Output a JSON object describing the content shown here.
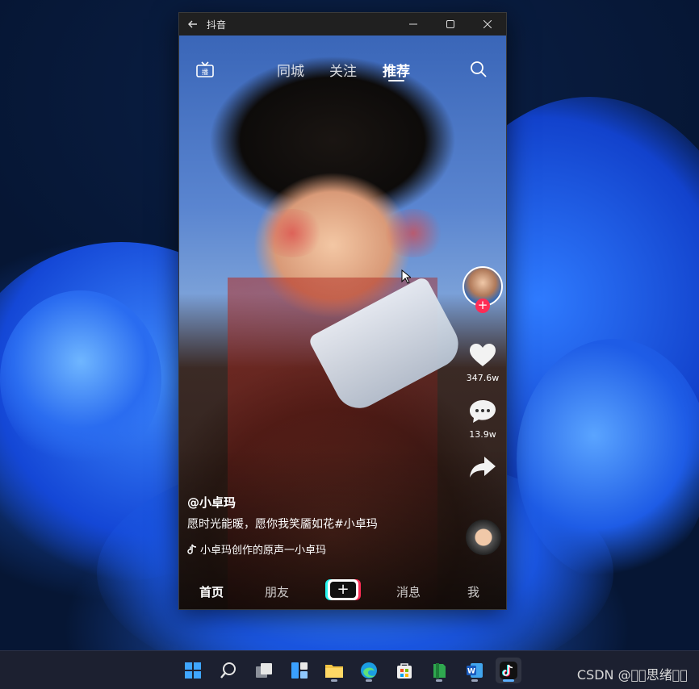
{
  "window": {
    "title": "抖音",
    "back_icon": "arrow-left-icon",
    "controls": [
      "minimize-icon",
      "maximize-icon",
      "close-icon"
    ]
  },
  "top_nav": {
    "live_icon": "live-icon",
    "tabs": [
      {
        "label": "同城",
        "active": false
      },
      {
        "label": "关注",
        "active": false
      },
      {
        "label": "推荐",
        "active": true
      }
    ],
    "search_icon": "search-icon"
  },
  "actions": {
    "likes": "347.6w",
    "comments": "13.9w",
    "follow_symbol": "+"
  },
  "caption": {
    "author": "@小卓玛",
    "description": "愿时光能暖，愿你我笑靥如花#小卓玛",
    "music": "小卓玛创作的原声一小卓玛"
  },
  "bottom_nav": {
    "items": [
      {
        "label": "首页",
        "active": true
      },
      {
        "label": "朋友",
        "active": false
      },
      {
        "label": "+",
        "active": false
      },
      {
        "label": "消息",
        "active": false
      },
      {
        "label": "我",
        "active": false
      }
    ]
  },
  "taskbar": {
    "icons": [
      "windows-start-icon",
      "search-icon",
      "task-view-icon",
      "widgets-icon",
      "file-explorer-icon",
      "edge-icon",
      "store-icon",
      "green-app-icon",
      "word-icon",
      "douyin-icon"
    ],
    "watermark": "CSDN @\u0000\u0000思绪\u0000\u0000"
  },
  "colors": {
    "accent": "#fe2c55",
    "cyan": "#25f4ee",
    "taskbar": "#1c2030",
    "titlebar": "#202020"
  }
}
